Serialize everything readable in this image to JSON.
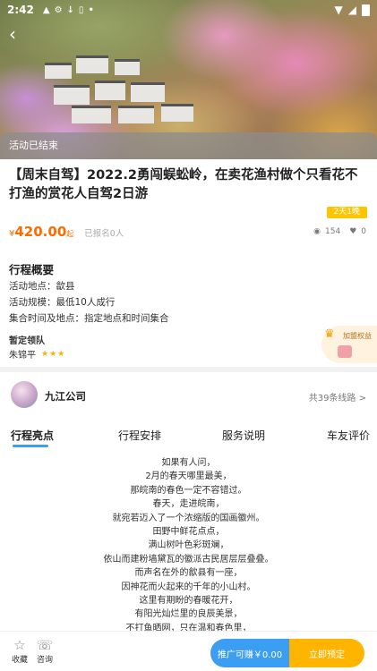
{
  "status_bar": {
    "time": "2:42",
    "icons": [
      "notification-icon",
      "settings-icon",
      "download-icon",
      "sim-icon",
      "dot-icon"
    ]
  },
  "hero": {
    "banner": "活动已结束"
  },
  "trip": {
    "title": "【周末自驾】2022.2勇闯蜈蚣岭，在卖花渔村做个只看花不打渔的赏花人自驾2日游",
    "tag": "2天1晚",
    "price_symbol": "¥",
    "price": "420.00",
    "price_unit": "起",
    "signed_up": "已报名0人",
    "views": "154",
    "likes": "0"
  },
  "overview": {
    "heading": "行程概要",
    "location": "活动地点：歙县",
    "scale": "活动规模：最低10人成行",
    "gather": "集合时间及地点：指定地点和时间集合",
    "leader_heading": "暂定领队",
    "leader_name": "朱锦平",
    "leader_stars": "★★★",
    "member_badge": "加盟权益"
  },
  "company": {
    "name": "九江公司",
    "routes": "共39条线路 >"
  },
  "tabs": [
    "行程亮点",
    "行程安排",
    "服务说明",
    "车友评价"
  ],
  "poem": [
    "如果有人问，",
    "2月的春天哪里最美，",
    "那皖南的春色一定不容错过。",
    "春天，走进皖南，",
    "就宛若迈入了一个浓缩版的国画徽州。",
    "田野中鲜花点点，",
    "满山树叶色彩斑斓，",
    "依山而建粉墙黛瓦的徽派古民居层层叠叠。",
    "而声名在外的歙县有一座，",
    "因神花而火起来的千年的小山村。",
    "这里有期盼的春暖花开，",
    "有阳光灿烂里的良辰美景，",
    "不打鱼晒网，只在温和春色里，"
  ],
  "bottom": {
    "collect": "收藏",
    "consult": "咨询",
    "promo": "推广可赚￥0.00",
    "book": "立即预定"
  }
}
